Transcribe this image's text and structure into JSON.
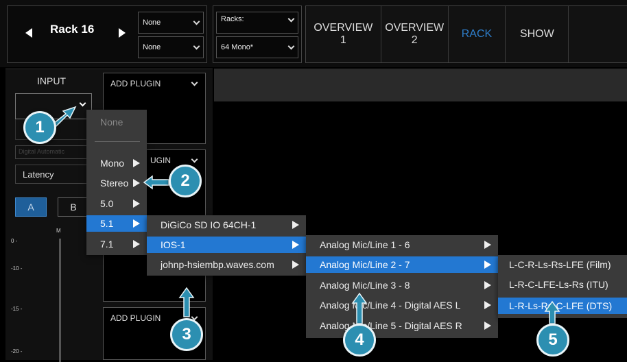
{
  "header": {
    "rack_name": "Rack 16",
    "input_select_1": "None",
    "input_select_2": "None",
    "racks_label": "Racks:",
    "racks_value": "64 Mono*"
  },
  "tabs": [
    {
      "line1": "OVERVIEW",
      "line2": "1"
    },
    {
      "line1": "OVERVIEW",
      "line2": "2"
    },
    {
      "line1": "RACK",
      "line2": ""
    },
    {
      "line1": "SHOW",
      "line2": ""
    }
  ],
  "active_tab": "RACK",
  "left_panel": {
    "input_label": "INPUT",
    "faded_text": "Digital Automatic",
    "latency_label": "Latency",
    "btn_a": "A",
    "btn_b": "B",
    "meter_label": "M",
    "scale": [
      "0 -",
      "-10 -",
      "-15 -",
      "-20 -"
    ],
    "add_plugin_1": "ADD PLUGIN",
    "add_plugin_2_partial": "UGIN",
    "add_plugin_3": "ADD PLUGIN"
  },
  "menu_formats": {
    "none": "None",
    "items": [
      "Mono",
      "Stereo",
      "5.0",
      "5.1",
      "7.1"
    ],
    "highlighted": "5.1"
  },
  "menu_devices": {
    "items": [
      "DiGiCo SD IO 64CH-1",
      "IOS-1",
      "johnp-hsiembp.waves.com"
    ],
    "highlighted": "IOS-1"
  },
  "menu_channels": {
    "items": [
      "Analog Mic/Line 1 - 6",
      "Analog Mic/Line 2 - 7",
      "Analog Mic/Line 3 - 8",
      "Analog Mic/Line 4 - Digital AES L",
      "Analog Mic/Line 5 - Digital AES R"
    ],
    "highlighted": "Analog Mic/Line 2 - 7"
  },
  "menu_layouts": {
    "items": [
      "L-C-R-Ls-Rs-LFE (Film)",
      "L-R-C-LFE-Ls-Rs (ITU)",
      "L-R-Ls-Rs-C-LFE (DTS)"
    ],
    "highlighted": "L-R-Ls-Rs-C-LFE (DTS)"
  },
  "callouts": [
    "1",
    "2",
    "3",
    "4",
    "5"
  ],
  "colors": {
    "highlight": "#2378d2",
    "callout": "#2c8fb1",
    "active_tab": "#2e7ecb",
    "ab_button": "#1f5f9a"
  }
}
